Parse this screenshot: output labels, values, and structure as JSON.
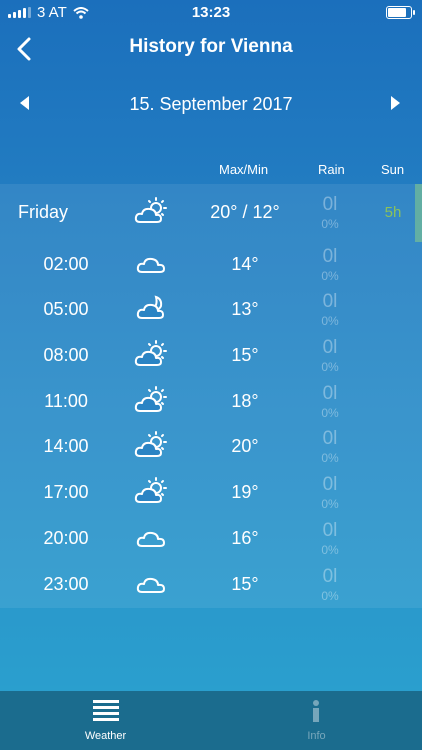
{
  "status": {
    "carrier": "3 AT",
    "time": "13:23"
  },
  "header": {
    "title": "History for Vienna"
  },
  "date_nav": {
    "date": "15. September 2017"
  },
  "columns": {
    "maxmin": "Max/Min",
    "rain": "Rain",
    "sun": "Sun"
  },
  "summary": {
    "label": "Friday",
    "icon": "sun-cloud-icon",
    "temp": "20° / 12°",
    "rain": "0l",
    "rain_pct": "0%",
    "sun": "5h"
  },
  "hours": [
    {
      "time": "02:00",
      "icon": "cloud-icon",
      "temp": "14°",
      "rain": "0l",
      "rain_pct": "0%"
    },
    {
      "time": "05:00",
      "icon": "moon-cloud-icon",
      "temp": "13°",
      "rain": "0l",
      "rain_pct": "0%"
    },
    {
      "time": "08:00",
      "icon": "sun-cloud-icon",
      "temp": "15°",
      "rain": "0l",
      "rain_pct": "0%"
    },
    {
      "time": "11:00",
      "icon": "sun-cloud-icon",
      "temp": "18°",
      "rain": "0l",
      "rain_pct": "0%"
    },
    {
      "time": "14:00",
      "icon": "sun-cloud-icon",
      "temp": "20°",
      "rain": "0l",
      "rain_pct": "0%"
    },
    {
      "time": "17:00",
      "icon": "sun-cloud-icon",
      "temp": "19°",
      "rain": "0l",
      "rain_pct": "0%"
    },
    {
      "time": "20:00",
      "icon": "cloud-icon",
      "temp": "16°",
      "rain": "0l",
      "rain_pct": "0%"
    },
    {
      "time": "23:00",
      "icon": "cloud-icon",
      "temp": "15°",
      "rain": "0l",
      "rain_pct": "0%"
    }
  ],
  "tabs": [
    {
      "label": "Weather",
      "icon": "list-icon",
      "active": true
    },
    {
      "label": "Info",
      "icon": "info-icon",
      "active": false
    }
  ],
  "colors": {
    "sun_value": "#8cc25a",
    "tabbar": "#1b6c8e",
    "top": "#1b6fbc",
    "bottom": "#2aa3cf"
  }
}
